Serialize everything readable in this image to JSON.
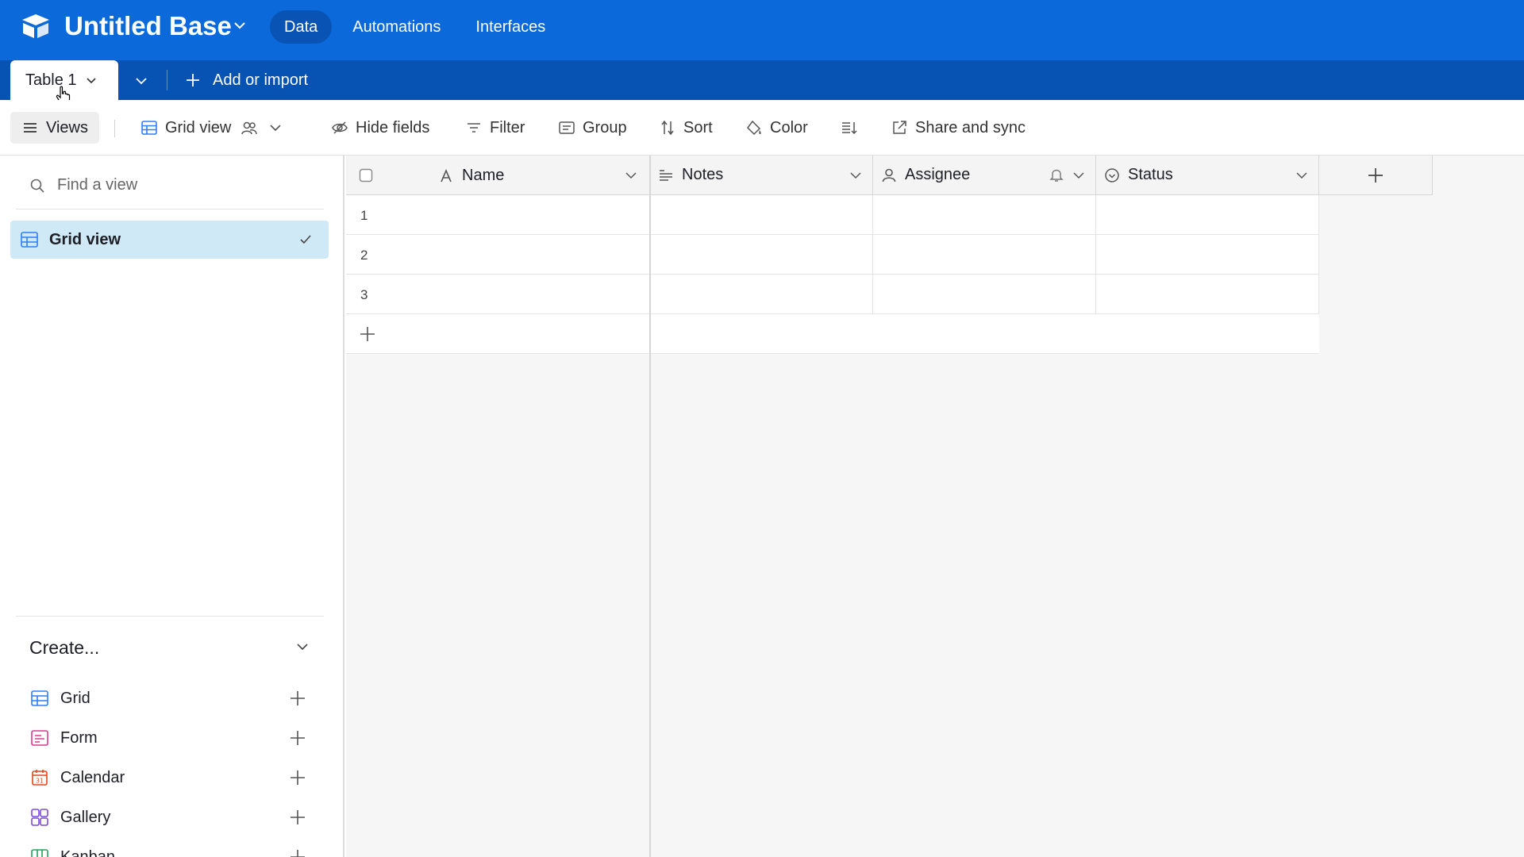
{
  "app": {
    "title": "Untitled Base",
    "nav": [
      {
        "label": "Data",
        "active": true
      },
      {
        "label": "Automations",
        "active": false
      },
      {
        "label": "Interfaces",
        "active": false
      }
    ],
    "colors": {
      "primary": "#0b69d9",
      "tabbar": "#0653b4",
      "selected_view": "#cfe9f7"
    }
  },
  "tabs": {
    "active_table": "Table 1",
    "add_label": "Add or import"
  },
  "viewbar": {
    "views_label": "Views",
    "view_name": "Grid view",
    "hide_fields": "Hide fields",
    "filter": "Filter",
    "group": "Group",
    "sort": "Sort",
    "color": "Color",
    "share": "Share and sync"
  },
  "sidebar": {
    "search_placeholder": "Find a view",
    "views": [
      {
        "label": "Grid view",
        "selected": true
      }
    ],
    "create_title": "Create...",
    "create_items": [
      {
        "label": "Grid",
        "icon": "grid-icon",
        "color": "#2d7ff9"
      },
      {
        "label": "Form",
        "icon": "form-icon",
        "color": "#dc3a8d"
      },
      {
        "label": "Calendar",
        "icon": "calendar-icon",
        "color": "#e0481f"
      },
      {
        "label": "Gallery",
        "icon": "gallery-icon",
        "color": "#7c4bd9"
      },
      {
        "label": "Kanban",
        "icon": "kanban-icon",
        "color": "#20a35a"
      }
    ]
  },
  "grid": {
    "columns": [
      {
        "label": "Name",
        "icon": "text-field-icon"
      },
      {
        "label": "Notes",
        "icon": "long-text-icon"
      },
      {
        "label": "Assignee",
        "icon": "user-icon"
      },
      {
        "label": "Status",
        "icon": "status-icon"
      }
    ],
    "rows": [
      {
        "num": "1",
        "cells": [
          "",
          "",
          "",
          ""
        ]
      },
      {
        "num": "2",
        "cells": [
          "",
          "",
          "",
          ""
        ]
      },
      {
        "num": "3",
        "cells": [
          "",
          "",
          "",
          ""
        ]
      }
    ]
  }
}
